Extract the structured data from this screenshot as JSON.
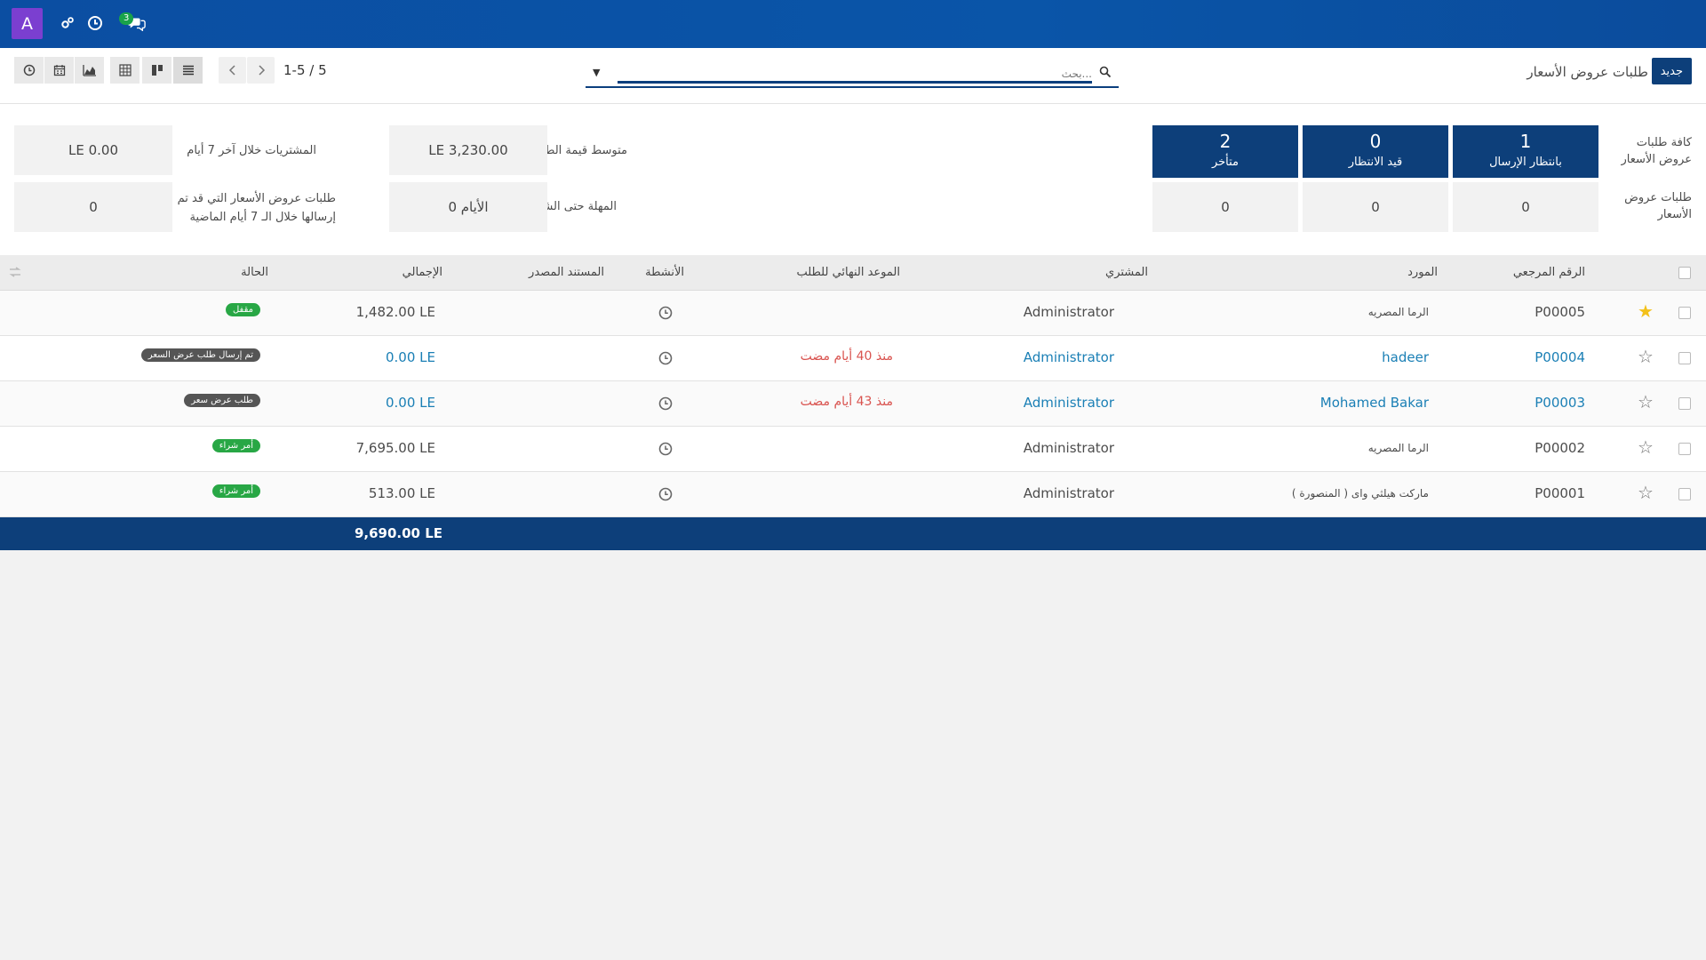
{
  "topbar": {
    "avatar_letter": "A",
    "chat_badge": "3",
    "icons": [
      "settings-icon",
      "clock-icon",
      "chat-icon"
    ]
  },
  "control_panel": {
    "title": "طلبات عروض الأسعار",
    "new_button": "جديد",
    "search_placeholder": "بحث...",
    "pager": "1-5 / 5",
    "views": [
      "list-view-icon",
      "kanban-view-icon",
      "pivot-view-icon",
      "graph-view-icon",
      "calendar-view-icon",
      "activity-view-icon"
    ]
  },
  "dashboard": {
    "row1_label": "كافة طلبات عروض الأسعار",
    "row2_label": "طلبات عروض الأسعار",
    "tiles": [
      {
        "num": "1",
        "label": "بانتظار الإرسال",
        "sub": "0"
      },
      {
        "num": "0",
        "label": "قيد الانتظار",
        "sub": "0"
      },
      {
        "num": "2",
        "label": "متأخر",
        "sub": "0"
      }
    ],
    "kpis": {
      "avg_order_label": "متوسط قيمة الطلب",
      "avg_order_value": "LE 3,230.00",
      "purchased_label": "المشتريات خلال آخر 7 أيام",
      "purchased_value": "LE 0.00",
      "lead_time_label": "المهلة حتى الشراء",
      "lead_time_value": "0 الأيام",
      "rfq_sent_label_1": "طلبات عروض الأسعار التي قد تم",
      "rfq_sent_label_2": "إرسالها خلال الـ 7 أيام الماضية",
      "rfq_sent_value": "0"
    }
  },
  "table": {
    "headers": {
      "reference": "الرقم المرجعي",
      "vendor": "المورد",
      "buyer": "المشتري",
      "deadline": "الموعد النهائي للطلب",
      "activities": "الأنشطة",
      "source": "المستند المصدر",
      "total": "الإجمالي",
      "status": "الحالة"
    },
    "rows": [
      {
        "ref": "P00005",
        "vendor": "الرما المصريه",
        "buyer": "Administrator",
        "deadline": "",
        "total": "1,482.00 LE",
        "status": "مقفل",
        "starred": true,
        "highlight": false
      },
      {
        "ref": "P00004",
        "vendor": "hadeer",
        "buyer": "Administrator",
        "deadline": "منذ 40 أيام مضت",
        "total": "0.00 LE",
        "status": "تم إرسال طلب عرض السعر",
        "starred": false,
        "highlight": true
      },
      {
        "ref": "P00003",
        "vendor": "Mohamed Bakar",
        "buyer": "Administrator",
        "deadline": "منذ 43 أيام مضت",
        "total": "0.00 LE",
        "status": "طلب عرض سعر",
        "starred": false,
        "highlight": true
      },
      {
        "ref": "P00002",
        "vendor": "الرما المصريه",
        "buyer": "Administrator",
        "deadline": "",
        "total": "7,695.00 LE",
        "status": "أمر شراء",
        "starred": false,
        "highlight": false
      },
      {
        "ref": "P00001",
        "vendor": "ماركت هيلثي واى ( المنصورة )",
        "buyer": "Administrator",
        "deadline": "",
        "total": "513.00 LE",
        "status": "أمر شراء",
        "starred": false,
        "highlight": false
      }
    ],
    "footer_total": "9,690.00 LE"
  },
  "colors": {
    "topbar": "#0b4ea2",
    "primary": "#0d3f7a",
    "link": "#1a7fb5",
    "overdue": "#d9534f",
    "status_done": "#28a745",
    "status_draft": "#555555",
    "star": "#f3c11a"
  }
}
